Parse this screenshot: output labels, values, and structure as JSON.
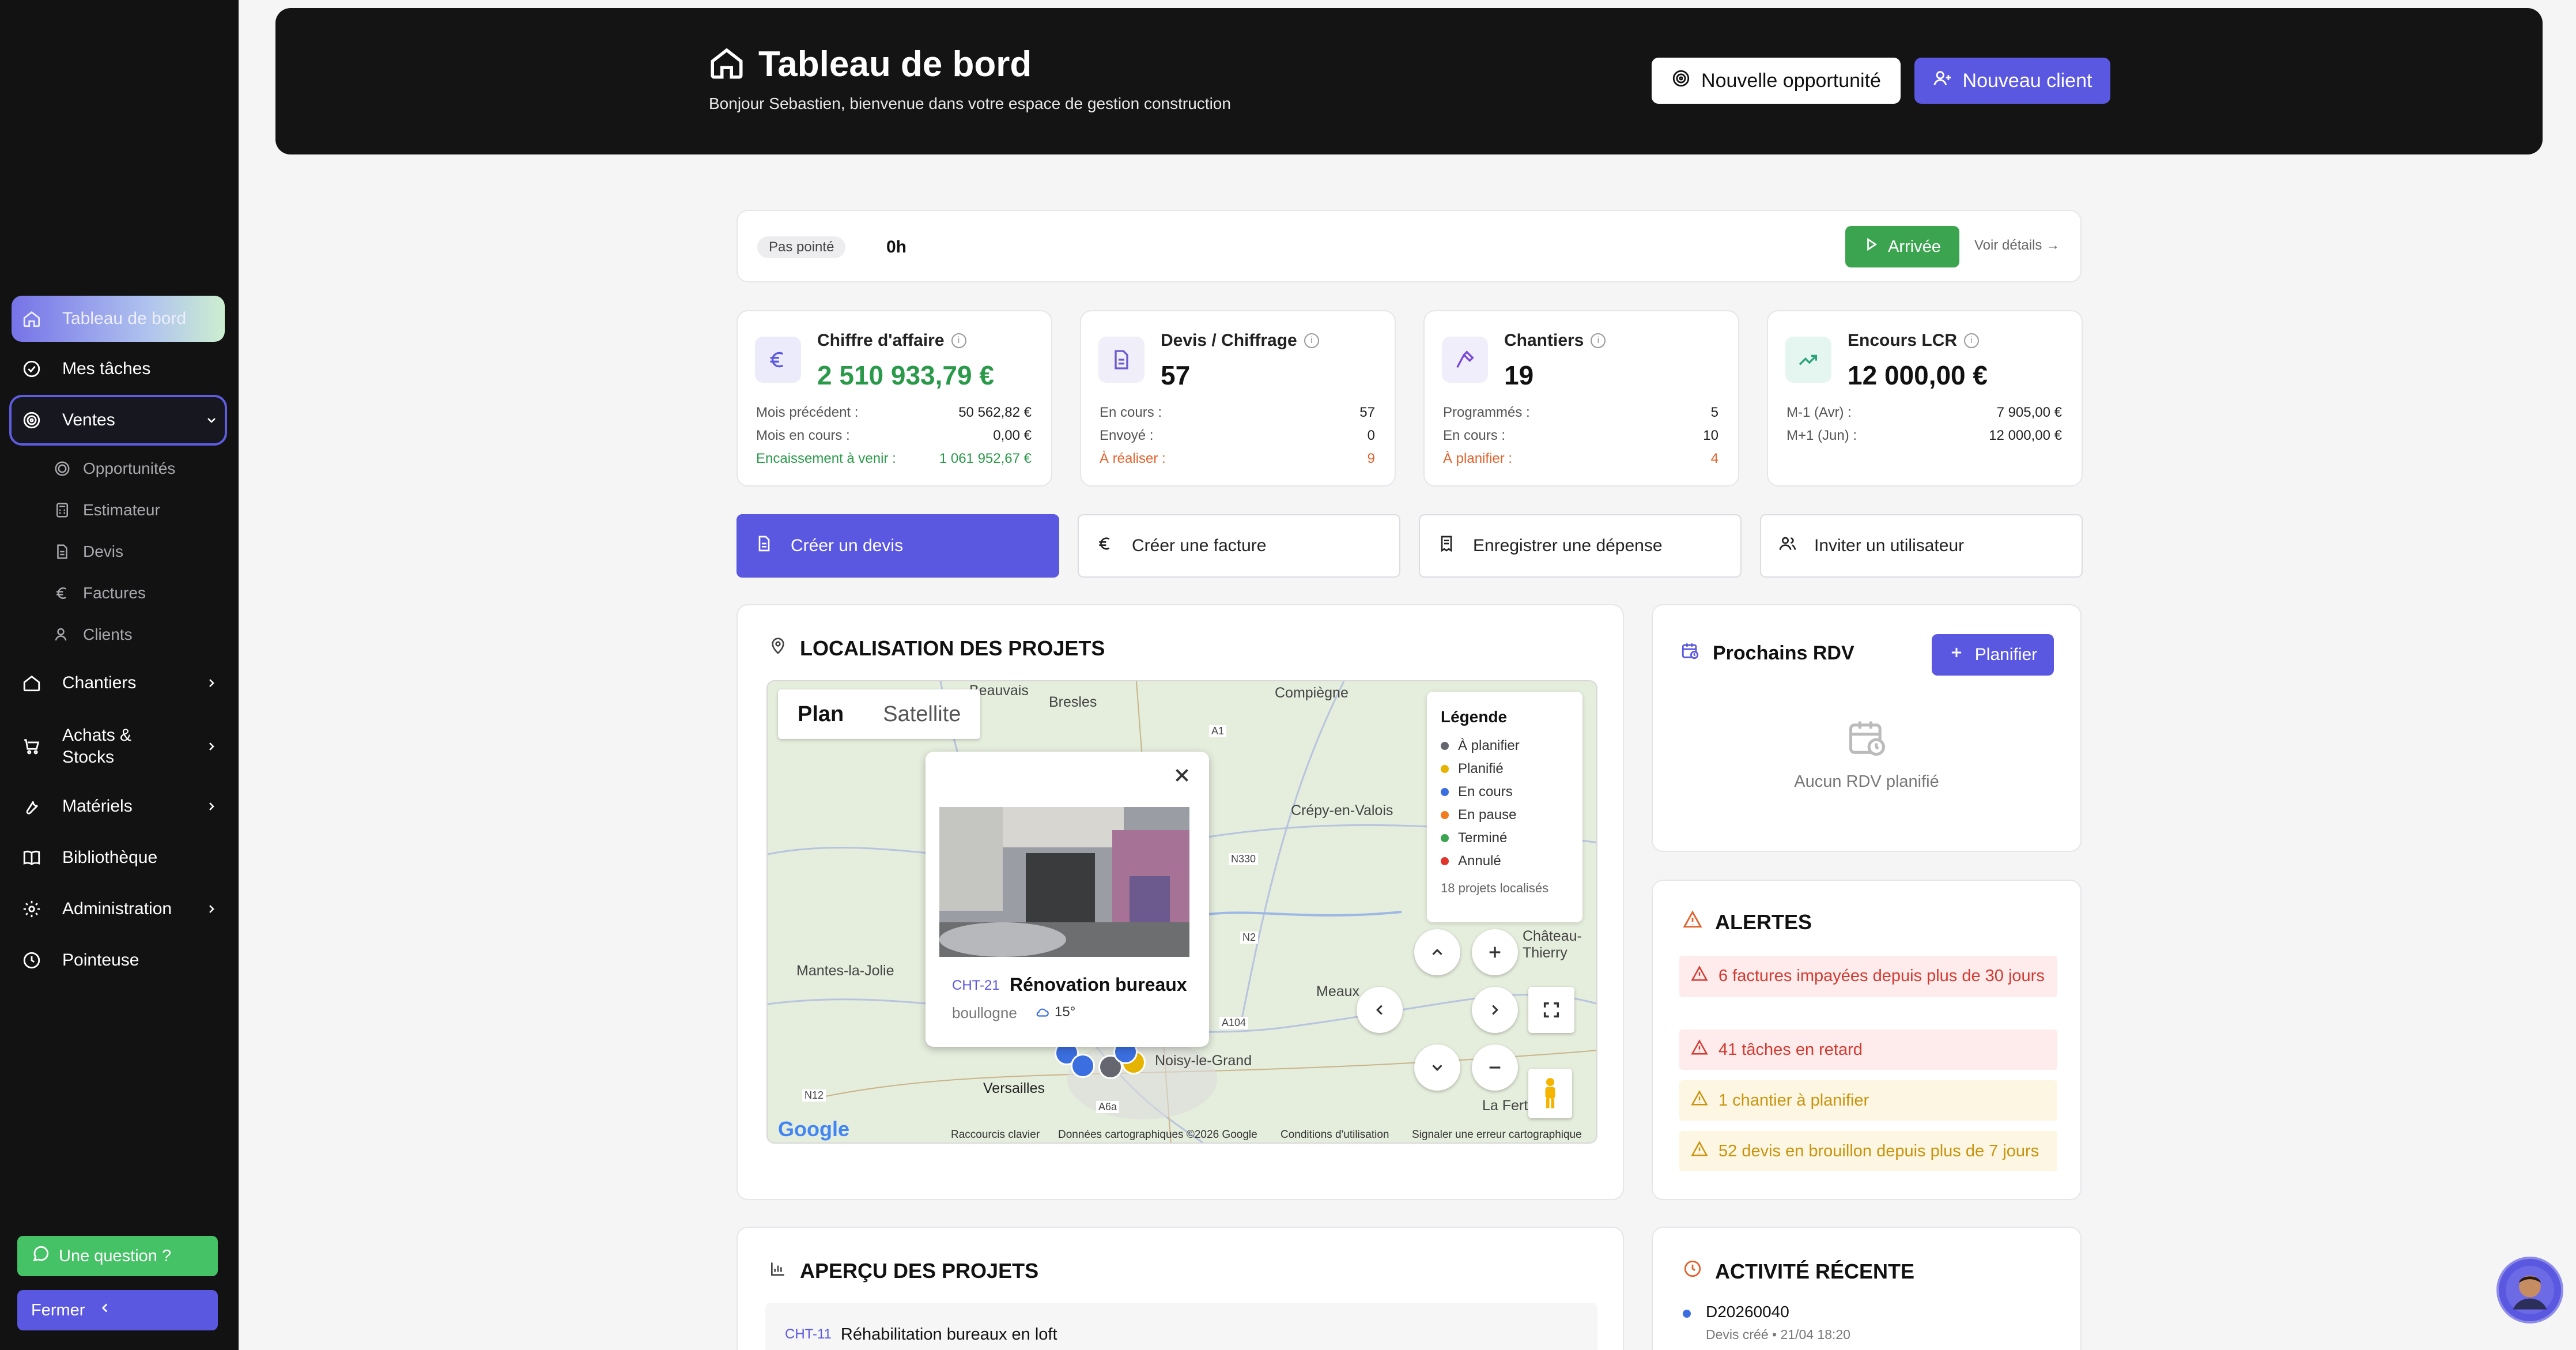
{
  "sidebar": {
    "items": [
      {
        "label": "Tableau de bord",
        "icon": "home-icon"
      },
      {
        "label": "Mes tâches",
        "icon": "check-circle-icon"
      },
      {
        "label": "Ventes",
        "icon": "target-icon"
      },
      {
        "label": "Chantiers",
        "icon": "home-icon"
      },
      {
        "label": "Achats & Stocks",
        "icon": "cart-icon"
      },
      {
        "label": "Matériels",
        "icon": "wrench-icon"
      },
      {
        "label": "Bibliothèque",
        "icon": "book-icon"
      },
      {
        "label": "Administration",
        "icon": "gear-icon"
      },
      {
        "label": "Pointeuse",
        "icon": "clock-icon"
      }
    ],
    "ventes_sub": [
      {
        "label": "Opportunités",
        "icon": "target-icon"
      },
      {
        "label": "Estimateur",
        "icon": "calculator-icon"
      },
      {
        "label": "Devis",
        "icon": "document-icon"
      },
      {
        "label": "Factures",
        "icon": "euro-icon"
      },
      {
        "label": "Clients",
        "icon": "user-icon"
      }
    ],
    "help_label": "Une question ?",
    "close_label": "Fermer"
  },
  "header": {
    "title": "Tableau de bord",
    "subtitle": "Bonjour Sebastien, bienvenue dans votre espace de gestion construction",
    "btn_opportunity": "Nouvelle opportunité",
    "btn_client": "Nouveau client"
  },
  "pointage": {
    "status": "Pas pointé",
    "hours": "0h",
    "arrive_label": "Arrivée",
    "details_label": "Voir détails →"
  },
  "stats": [
    {
      "title": "Chiffre d'affaire",
      "value": "2 510 933,79 €",
      "value_color": "#2a9a4a",
      "icon": "euro-icon",
      "icon_bg": "#ecebfb",
      "icon_color": "#5a57e0",
      "rows": [
        {
          "label": "Mois précédent :",
          "value": "50 562,82 €",
          "color": ""
        },
        {
          "label": "Mois en cours :",
          "value": "0,00 €",
          "color": ""
        },
        {
          "label": "Encaissement à venir :",
          "value": "1 061 952,67 €",
          "color": "#2a9a4a"
        }
      ]
    },
    {
      "title": "Devis / Chiffrage",
      "value": "57",
      "value_color": "#111",
      "icon": "document-icon",
      "icon_bg": "#f0eef9",
      "icon_color": "#6a5acd",
      "rows": [
        {
          "label": "En cours :",
          "value": "57",
          "color": ""
        },
        {
          "label": "Envoyé :",
          "value": "0",
          "color": ""
        },
        {
          "label": "À réaliser :",
          "value": "9",
          "color": "#e0622c"
        }
      ]
    },
    {
      "title": "Chantiers",
      "value": "19",
      "value_color": "#111",
      "icon": "hammer-icon",
      "icon_bg": "#f1eefb",
      "icon_color": "#7a4ad8",
      "rows": [
        {
          "label": "Programmés :",
          "value": "5",
          "color": ""
        },
        {
          "label": "En cours :",
          "value": "10",
          "color": ""
        },
        {
          "label": "À planifier :",
          "value": "4",
          "color": "#e0622c"
        }
      ]
    },
    {
      "title": "Encours LCR",
      "value": "12 000,00 €",
      "value_color": "#111",
      "icon": "trending-up-icon",
      "icon_bg": "#e4f6ef",
      "icon_color": "#2aa37a",
      "rows": [
        {
          "label": "M-1 (Avr) :",
          "value": "7 905,00 €",
          "color": ""
        },
        {
          "label": "M+1 (Jun) :",
          "value": "12 000,00 €",
          "color": ""
        }
      ]
    }
  ],
  "actions": [
    {
      "label": "Créer un devis",
      "icon": "document-icon"
    },
    {
      "label": "Créer une facture",
      "icon": "euro-icon"
    },
    {
      "label": "Enregistrer une dépense",
      "icon": "receipt-icon"
    },
    {
      "label": "Inviter un utilisateur",
      "icon": "users-icon"
    }
  ],
  "location": {
    "title": "LOCALISATION DES PROJETS",
    "tab_plan": "Plan",
    "tab_satellite": "Satellite",
    "places": [
      {
        "name": "Beauvais"
      },
      {
        "name": "Bresles"
      },
      {
        "name": "Compiègne"
      },
      {
        "name": "Crépy-en-Valois"
      },
      {
        "name": "Mantes-la-Jolie"
      },
      {
        "name": "Meaux"
      },
      {
        "name": "Versailles"
      },
      {
        "name": "Noisy-le-Grand"
      },
      {
        "name": "La Ferté-Gau"
      },
      {
        "name": "Château-Thierry"
      }
    ],
    "roads": [
      "A1",
      "N330",
      "N2",
      "A104",
      "N12",
      "A6a"
    ],
    "legend": {
      "title": "Légende",
      "items": [
        {
          "label": "À planifier",
          "color": "#666670"
        },
        {
          "label": "Planifié",
          "color": "#e5b300"
        },
        {
          "label": "En cours",
          "color": "#3b6fe0"
        },
        {
          "label": "En pause",
          "color": "#f07c1e"
        },
        {
          "label": "Terminé",
          "color": "#3ba44f"
        },
        {
          "label": "Annulé",
          "color": "#e0352b"
        }
      ],
      "count": "18 projets localisés"
    },
    "popup": {
      "code": "CHT-21",
      "name": "Rénovation bureaux",
      "city": "boullogne",
      "temp": "15°"
    },
    "google": "Google",
    "footer": {
      "shortcuts": "Raccourcis clavier",
      "data": "Données cartographiques ©2026 Google",
      "terms": "Conditions d'utilisation",
      "report": "Signaler une erreur cartographique"
    }
  },
  "rdv": {
    "title": "Prochains RDV",
    "btn": "Planifier",
    "empty": "Aucun RDV planifié"
  },
  "alerts": {
    "title": "ALERTES",
    "items": [
      {
        "text": "6 factures impayées depuis plus de 30 jours",
        "level": "red"
      },
      {
        "text": "41 tâches en retard",
        "level": "red"
      },
      {
        "text": "1 chantier à planifier",
        "level": "yel"
      },
      {
        "text": "52 devis en brouillon depuis plus de 7 jours",
        "level": "yel"
      }
    ]
  },
  "projects": {
    "title": "APERÇU DES PROJETS",
    "first": {
      "code": "CHT-11",
      "name": "Réhabilitation bureaux en loft"
    }
  },
  "activity": {
    "title": "ACTIVITÉ RÉCENTE",
    "first": {
      "ref": "D20260040",
      "meta": "Devis créé • 21/04 18:20"
    }
  }
}
